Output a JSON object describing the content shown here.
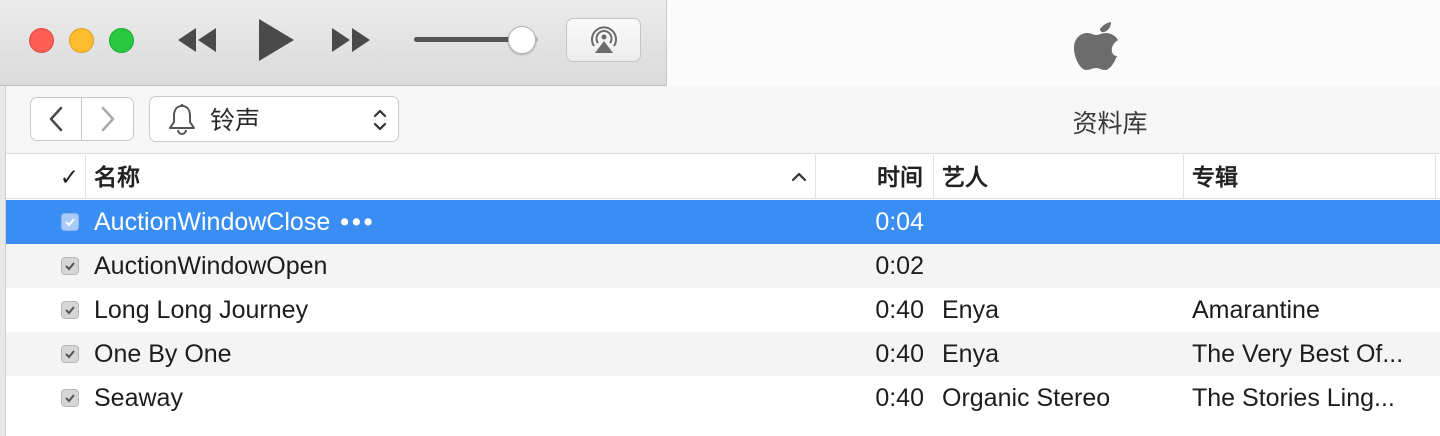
{
  "window": {
    "controls": [
      "close",
      "minimize",
      "zoom"
    ]
  },
  "player": {
    "rewind_icon": "rewind-icon",
    "play_icon": "play-icon",
    "forward_icon": "fast-forward-icon",
    "volume_level": 0.87,
    "airplay_icon": "airplay-icon",
    "lcd_logo": "apple-logo"
  },
  "nav": {
    "back_icon": "chevron-left-icon",
    "forward_icon": "chevron-right-icon",
    "media_type_icon": "bell-icon",
    "media_type_label": "铃声",
    "library_title": "资料库"
  },
  "table": {
    "columns": {
      "check": "✓",
      "name": "名称",
      "time": "时间",
      "artist": "艺人",
      "album": "专辑"
    },
    "sort_icon": "chevron-up-icon",
    "rows": [
      {
        "checked": true,
        "name": "AuctionWindowClose",
        "more": "•••",
        "time": "0:04",
        "artist": "",
        "album": "",
        "selected": true
      },
      {
        "checked": true,
        "name": "AuctionWindowOpen",
        "more": "",
        "time": "0:02",
        "artist": "",
        "album": "",
        "selected": false
      },
      {
        "checked": true,
        "name": "Long Long Journey",
        "more": "",
        "time": "0:40",
        "artist": "Enya",
        "album": "Amarantine",
        "selected": false
      },
      {
        "checked": true,
        "name": "One By One",
        "more": "",
        "time": "0:40",
        "artist": "Enya",
        "album": "The Very Best Of...",
        "selected": false
      },
      {
        "checked": true,
        "name": "Seaway",
        "more": "",
        "time": "0:40",
        "artist": "Organic Stereo",
        "album": "The Stories Ling...",
        "selected": false
      }
    ]
  },
  "colors": {
    "selection": "#3a8ef3",
    "close": "#fd5f57",
    "minimize": "#febc2e",
    "zoom": "#28c840"
  }
}
